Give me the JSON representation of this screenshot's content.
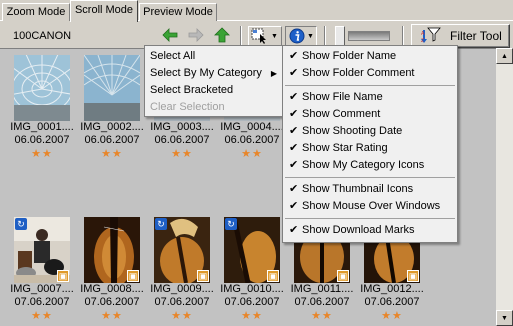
{
  "tabs": [
    {
      "label": "Zoom Mode"
    },
    {
      "label": "Scroll Mode"
    },
    {
      "label": "Preview Mode"
    }
  ],
  "toolbar": {
    "folder_name": "100CANON",
    "filter_tool_label": "Filter Tool"
  },
  "select_menu": {
    "items": [
      {
        "label": "Select All"
      },
      {
        "label": "Select By My Category"
      },
      {
        "label": "Select Bracketed"
      },
      {
        "label": "Clear Selection"
      }
    ]
  },
  "info_menu": {
    "items": [
      {
        "label": "Show Folder Name",
        "checked": true
      },
      {
        "label": "Show Folder Comment",
        "checked": true
      },
      {
        "label": "Show File Name",
        "checked": true
      },
      {
        "label": "Show Comment",
        "checked": true
      },
      {
        "label": "Show Shooting Date",
        "checked": true
      },
      {
        "label": "Show Star Rating",
        "checked": true
      },
      {
        "label": "Show My Category Icons",
        "checked": true
      },
      {
        "label": "Show Thumbnail Icons",
        "checked": true
      },
      {
        "label": "Show Mouse Over Windows",
        "checked": true
      },
      {
        "label": "Show Download Marks",
        "checked": true
      }
    ]
  },
  "thumbnails": {
    "row1": [
      {
        "name": "IMG_0001....",
        "date": "06.06.2007",
        "stars": "★★"
      },
      {
        "name": "IMG_0002....",
        "date": "06.06.2007",
        "stars": "★★"
      },
      {
        "name": "IMG_0003....",
        "date": "06.06.2007",
        "stars": "★★"
      },
      {
        "name": "IMG_0004....",
        "date": "06.06.2007",
        "stars": "★★"
      }
    ],
    "row2": [
      {
        "name": "IMG_0007....",
        "date": "07.06.2007",
        "stars": "★★"
      },
      {
        "name": "IMG_0008....",
        "date": "07.06.2007",
        "stars": "★★"
      },
      {
        "name": "IMG_0009....",
        "date": "07.06.2007",
        "stars": "★★"
      },
      {
        "name": "IMG_0010....",
        "date": "07.06.2007",
        "stars": "★★"
      },
      {
        "name": "IMG_0011....",
        "date": "07.06.2007",
        "stars": "★★"
      },
      {
        "name": "IMG_0012....",
        "date": "07.06.2007",
        "stars": "★★"
      }
    ]
  },
  "colors": {
    "star": "#e8862a",
    "back_arrow": "#3aa335",
    "rotate_badge": "#1f5fc4",
    "category_badge": "#e09a2a",
    "info_icon": "#1d5fc8"
  }
}
